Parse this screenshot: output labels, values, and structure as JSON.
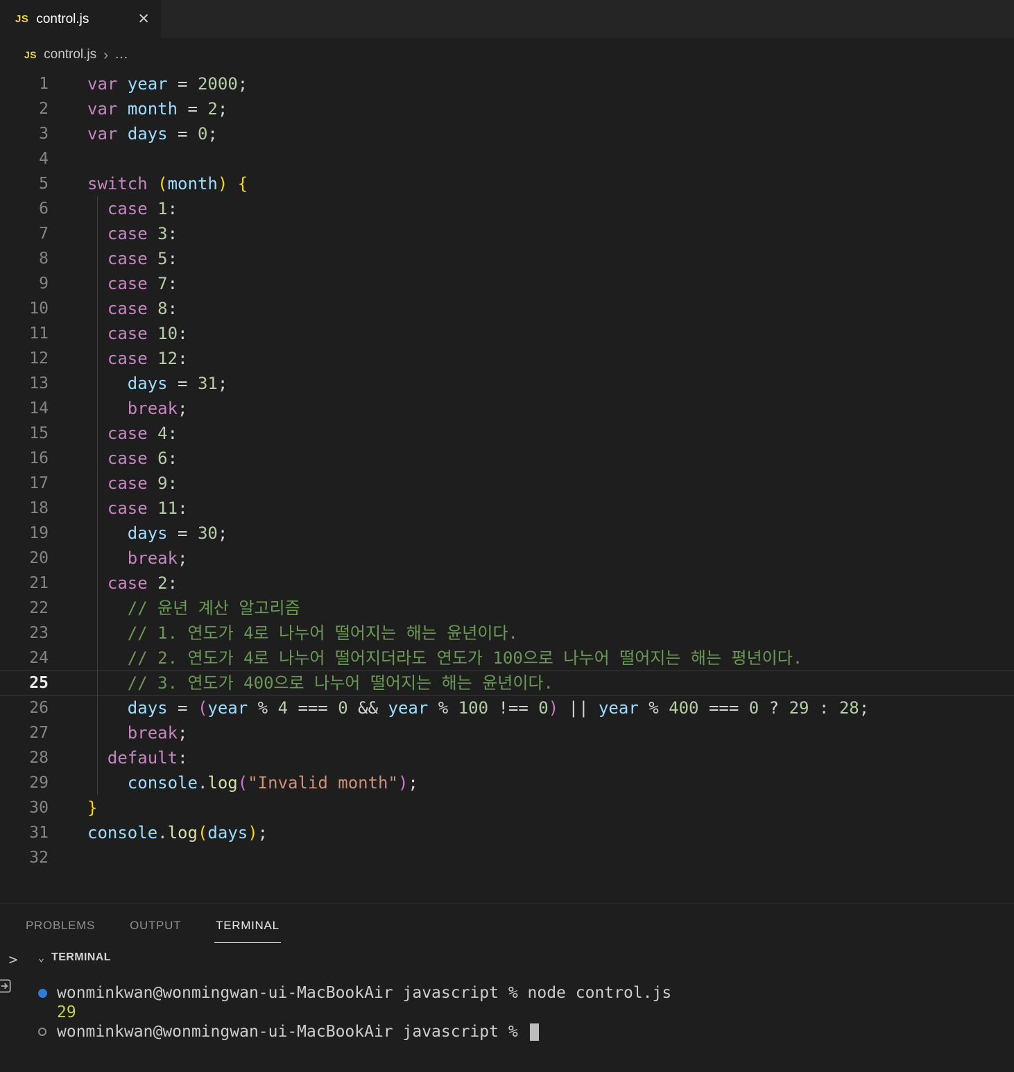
{
  "colors": {
    "editor_bg": "#1e1e1e",
    "tabbar_bg": "#252526",
    "js_icon_yellow": "#e8d44d",
    "terminal_decoration_blue": "#2e7cd6",
    "tokens": {
      "k": "#C586C0",
      "v": "#9CDCFE",
      "n": "#B5CEA8",
      "o": "#D4D4D4",
      "c": "#6A9955",
      "s": "#CE9178",
      "f": "#DCDCAA",
      "b1": "#FFD700",
      "b2": "#DA70D6",
      "t": "#cccccc",
      "y": "#cdcd4f"
    }
  },
  "tab": {
    "file_icon": "JS",
    "title": "control.js",
    "close_icon": "✕"
  },
  "breadcrumb": {
    "file_icon": "JS",
    "file": "control.js",
    "separator": "›",
    "more": "..."
  },
  "editor": {
    "active_line": 25,
    "lines": [
      {
        "n": 1,
        "tokens": [
          [
            "var",
            "k"
          ],
          [
            " ",
            "o"
          ],
          [
            "year",
            "v"
          ],
          [
            " = ",
            "o"
          ],
          [
            "2000",
            "n"
          ],
          [
            ";",
            "o"
          ]
        ]
      },
      {
        "n": 2,
        "tokens": [
          [
            "var",
            "k"
          ],
          [
            " ",
            "o"
          ],
          [
            "month",
            "v"
          ],
          [
            " = ",
            "o"
          ],
          [
            "2",
            "n"
          ],
          [
            ";",
            "o"
          ]
        ]
      },
      {
        "n": 3,
        "tokens": [
          [
            "var",
            "k"
          ],
          [
            " ",
            "o"
          ],
          [
            "days",
            "v"
          ],
          [
            " = ",
            "o"
          ],
          [
            "0",
            "n"
          ],
          [
            ";",
            "o"
          ]
        ]
      },
      {
        "n": 4,
        "tokens": []
      },
      {
        "n": 5,
        "tokens": [
          [
            "switch",
            "k"
          ],
          [
            " ",
            "o"
          ],
          [
            "(",
            "b1"
          ],
          [
            "month",
            "v"
          ],
          [
            ")",
            "b1"
          ],
          [
            " ",
            "o"
          ],
          [
            "{",
            "b1"
          ]
        ]
      },
      {
        "n": 6,
        "g": 1,
        "tokens": [
          [
            "  ",
            "o"
          ],
          [
            "case",
            "k"
          ],
          [
            " ",
            "o"
          ],
          [
            "1",
            "n"
          ],
          [
            ":",
            "o"
          ]
        ]
      },
      {
        "n": 7,
        "g": 1,
        "tokens": [
          [
            "  ",
            "o"
          ],
          [
            "case",
            "k"
          ],
          [
            " ",
            "o"
          ],
          [
            "3",
            "n"
          ],
          [
            ":",
            "o"
          ]
        ]
      },
      {
        "n": 8,
        "g": 1,
        "tokens": [
          [
            "  ",
            "o"
          ],
          [
            "case",
            "k"
          ],
          [
            " ",
            "o"
          ],
          [
            "5",
            "n"
          ],
          [
            ":",
            "o"
          ]
        ]
      },
      {
        "n": 9,
        "g": 1,
        "tokens": [
          [
            "  ",
            "o"
          ],
          [
            "case",
            "k"
          ],
          [
            " ",
            "o"
          ],
          [
            "7",
            "n"
          ],
          [
            ":",
            "o"
          ]
        ]
      },
      {
        "n": 10,
        "g": 1,
        "tokens": [
          [
            "  ",
            "o"
          ],
          [
            "case",
            "k"
          ],
          [
            " ",
            "o"
          ],
          [
            "8",
            "n"
          ],
          [
            ":",
            "o"
          ]
        ]
      },
      {
        "n": 11,
        "g": 1,
        "tokens": [
          [
            "  ",
            "o"
          ],
          [
            "case",
            "k"
          ],
          [
            " ",
            "o"
          ],
          [
            "10",
            "n"
          ],
          [
            ":",
            "o"
          ]
        ]
      },
      {
        "n": 12,
        "g": 1,
        "tokens": [
          [
            "  ",
            "o"
          ],
          [
            "case",
            "k"
          ],
          [
            " ",
            "o"
          ],
          [
            "12",
            "n"
          ],
          [
            ":",
            "o"
          ]
        ]
      },
      {
        "n": 13,
        "g": 1,
        "tokens": [
          [
            "    ",
            "o"
          ],
          [
            "days",
            "v"
          ],
          [
            " = ",
            "o"
          ],
          [
            "31",
            "n"
          ],
          [
            ";",
            "o"
          ]
        ]
      },
      {
        "n": 14,
        "g": 1,
        "tokens": [
          [
            "    ",
            "o"
          ],
          [
            "break",
            "k"
          ],
          [
            ";",
            "o"
          ]
        ]
      },
      {
        "n": 15,
        "g": 1,
        "tokens": [
          [
            "  ",
            "o"
          ],
          [
            "case",
            "k"
          ],
          [
            " ",
            "o"
          ],
          [
            "4",
            "n"
          ],
          [
            ":",
            "o"
          ]
        ]
      },
      {
        "n": 16,
        "g": 1,
        "tokens": [
          [
            "  ",
            "o"
          ],
          [
            "case",
            "k"
          ],
          [
            " ",
            "o"
          ],
          [
            "6",
            "n"
          ],
          [
            ":",
            "o"
          ]
        ]
      },
      {
        "n": 17,
        "g": 1,
        "tokens": [
          [
            "  ",
            "o"
          ],
          [
            "case",
            "k"
          ],
          [
            " ",
            "o"
          ],
          [
            "9",
            "n"
          ],
          [
            ":",
            "o"
          ]
        ]
      },
      {
        "n": 18,
        "g": 1,
        "tokens": [
          [
            "  ",
            "o"
          ],
          [
            "case",
            "k"
          ],
          [
            " ",
            "o"
          ],
          [
            "11",
            "n"
          ],
          [
            ":",
            "o"
          ]
        ]
      },
      {
        "n": 19,
        "g": 1,
        "tokens": [
          [
            "    ",
            "o"
          ],
          [
            "days",
            "v"
          ],
          [
            " = ",
            "o"
          ],
          [
            "30",
            "n"
          ],
          [
            ";",
            "o"
          ]
        ]
      },
      {
        "n": 20,
        "g": 1,
        "tokens": [
          [
            "    ",
            "o"
          ],
          [
            "break",
            "k"
          ],
          [
            ";",
            "o"
          ]
        ]
      },
      {
        "n": 21,
        "g": 1,
        "tokens": [
          [
            "  ",
            "o"
          ],
          [
            "case",
            "k"
          ],
          [
            " ",
            "o"
          ],
          [
            "2",
            "n"
          ],
          [
            ":",
            "o"
          ]
        ]
      },
      {
        "n": 22,
        "g": 1,
        "tokens": [
          [
            "    ",
            "o"
          ],
          [
            "// 윤년 계산 알고리즘",
            "c"
          ]
        ]
      },
      {
        "n": 23,
        "g": 1,
        "tokens": [
          [
            "    ",
            "o"
          ],
          [
            "// 1. 연도가 4로 나누어 떨어지는 해는 윤년이다.",
            "c"
          ]
        ]
      },
      {
        "n": 24,
        "g": 1,
        "tokens": [
          [
            "    ",
            "o"
          ],
          [
            "// 2. 연도가 4로 나누어 떨어지더라도 연도가 100으로 나누어 떨어지는 해는 평년이다.",
            "c"
          ]
        ]
      },
      {
        "n": 25,
        "g": 1,
        "tokens": [
          [
            "    ",
            "o"
          ],
          [
            "// 3. 연도가 400으로 나누어 떨어지는 해는 윤년이다.",
            "c"
          ]
        ]
      },
      {
        "n": 26,
        "g": 1,
        "tokens": [
          [
            "    ",
            "o"
          ],
          [
            "days",
            "v"
          ],
          [
            " = ",
            "o"
          ],
          [
            "(",
            "b2"
          ],
          [
            "year",
            "v"
          ],
          [
            " % ",
            "o"
          ],
          [
            "4",
            "n"
          ],
          [
            " === ",
            "o"
          ],
          [
            "0",
            "n"
          ],
          [
            " && ",
            "o"
          ],
          [
            "year",
            "v"
          ],
          [
            " % ",
            "o"
          ],
          [
            "100",
            "n"
          ],
          [
            " !== ",
            "o"
          ],
          [
            "0",
            "n"
          ],
          [
            ")",
            "b2"
          ],
          [
            " || ",
            "o"
          ],
          [
            "year",
            "v"
          ],
          [
            " % ",
            "o"
          ],
          [
            "400",
            "n"
          ],
          [
            " === ",
            "o"
          ],
          [
            "0",
            "n"
          ],
          [
            " ? ",
            "o"
          ],
          [
            "29",
            "n"
          ],
          [
            " : ",
            "o"
          ],
          [
            "28",
            "n"
          ],
          [
            ";",
            "o"
          ]
        ]
      },
      {
        "n": 27,
        "g": 1,
        "tokens": [
          [
            "    ",
            "o"
          ],
          [
            "break",
            "k"
          ],
          [
            ";",
            "o"
          ]
        ]
      },
      {
        "n": 28,
        "g": 1,
        "tokens": [
          [
            "  ",
            "o"
          ],
          [
            "default",
            "k"
          ],
          [
            ":",
            "o"
          ]
        ]
      },
      {
        "n": 29,
        "g": 1,
        "tokens": [
          [
            "    ",
            "o"
          ],
          [
            "console",
            "v"
          ],
          [
            ".",
            "o"
          ],
          [
            "log",
            "f"
          ],
          [
            "(",
            "b2"
          ],
          [
            "\"Invalid month\"",
            "s"
          ],
          [
            ")",
            "b2"
          ],
          [
            ";",
            "o"
          ]
        ]
      },
      {
        "n": 30,
        "tokens": [
          [
            "}",
            "b1"
          ]
        ]
      },
      {
        "n": 31,
        "tokens": [
          [
            "console",
            "v"
          ],
          [
            ".",
            "o"
          ],
          [
            "log",
            "f"
          ],
          [
            "(",
            "b1"
          ],
          [
            "days",
            "v"
          ],
          [
            ")",
            "b1"
          ],
          [
            ";",
            "o"
          ]
        ]
      },
      {
        "n": 32,
        "tokens": []
      }
    ]
  },
  "panel": {
    "tabs": [
      {
        "label": "PROBLEMS",
        "active": false
      },
      {
        "label": "OUTPUT",
        "active": false
      },
      {
        "label": "TERMINAL",
        "active": true
      }
    ],
    "side_chevron": ">"
  },
  "terminal": {
    "header": {
      "chevron": "⌄",
      "label": "TERMINAL"
    },
    "lines": [
      {
        "decoration": "success",
        "color": "t",
        "text": "wonminkwan@wonmingwan-ui-MacBookAir javascript % node control.js",
        "cursor": false
      },
      {
        "decoration": "none",
        "color": "y",
        "text": "29",
        "cursor": false
      },
      {
        "decoration": "pending",
        "color": "t",
        "text": "wonminkwan@wonmingwan-ui-MacBookAir javascript % ",
        "cursor": true
      }
    ]
  }
}
